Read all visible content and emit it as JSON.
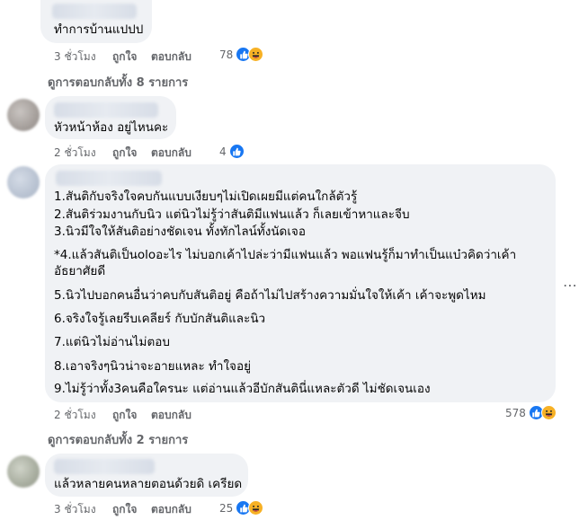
{
  "comment1": {
    "text": "ทำการบ้านแปปป",
    "time": "3 ชั่วโมง",
    "like": "ถูกใจ",
    "reply": "ตอบกลับ",
    "reactions": "78"
  },
  "replies1": "ดูการตอบกลับทั้ง 8 รายการ",
  "comment2": {
    "text": "หัวหน้าห้อง อยู่ไหนคะ",
    "time": "2 ชั่วโมง",
    "like": "ถูกใจ",
    "reply": "ตอบกลับ",
    "reactions": "4"
  },
  "comment3": {
    "lines": [
      "1.สันติกับจริงใจคบกันแบบเงียบๆไม่เปิดเผยมีแต่คนใกล้ตัวรู้",
      "2.สันติร่วมงานกับนิว แต่นิวไม่รู้ว่าสันติมีแฟนแล้ว ก็เลยเข้าหาและจีบ",
      "3.นิวมีใจให้สันติอย่างชัดเจน ทั้งทักไลน์ทั้งนัดเจอ",
      "*4.แล้วสันติเป็นoloอะไร ไม่บอกเค้าไปล่ะว่ามีแฟนแล้ว พอแฟนรู้ก็มาทำเป็นแบ๋วคิดว่าเค้า",
      "อัธยาศัยดี",
      "5.นิวไปบอกคนอื่นว่าคบกับสันติอยู่ คือถ้าไม่ไปสร้างความมั่นใจให้เค้า เค้าจะพูดไหม",
      "6.จริงใจรู้เลยรีบเคลียร์ กับบักสันติและนิว",
      "7.แต่นิวไม่อ่านไม่ตอบ",
      "8.เอาจริงๆนิวน่าจะอายแหละ ทำใจอยู่",
      "9.ไม่รู้ว่าทั้ง3คนคือใครนะ แต่อ่านแล้วอีบักสันตินี่แหละตัวดี ไม่ชัดเจนเอง"
    ],
    "time": "2 ชั่วโมง",
    "like": "ถูกใจ",
    "reply": "ตอบกลับ",
    "reactions": "578"
  },
  "replies3": "ดูการตอบกลับทั้ง 2 รายการ",
  "comment4": {
    "text": "แล้วหลายคนหลายตอนด้วยดิ เครียด",
    "time": "3 ชั่วโมง",
    "like": "ถูกใจ",
    "reply": "ตอบกลับ",
    "reactions": "25"
  },
  "more_icon": "more-options-icon",
  "colors": {
    "bubble": "#f0f2f5",
    "meta": "#65676b",
    "like": "#1877f2",
    "haha": "#f7b125"
  }
}
